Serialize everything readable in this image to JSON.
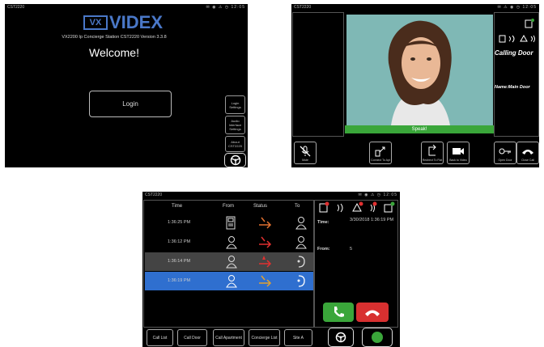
{
  "screen1": {
    "status_app": "CST2220",
    "status_icons": "✉ ◉ ⚠ ◷ 12:05",
    "logo_mark": "VX",
    "logo_text": "VIDEX",
    "version": "VX2200 Ip Concierge Station CST2220 Version 3.3.8",
    "welcome": "Welcome!",
    "login_button": "Login",
    "side_buttons": [
      "Login Settings",
      "Audio Interface Settings",
      "About CST2220"
    ]
  },
  "screen2": {
    "status_app": "CST2220",
    "status_icons": "✉ ⚠ ◉ ◷ 12:05",
    "speak_label": "Speak!",
    "calling_door": "Calling Door",
    "name_label": "Name:Main Door",
    "buttons": [
      "Mute",
      "Connect To Apt",
      "Redirect To Flat",
      "Back to Video",
      "Open Door",
      "Close Call"
    ]
  },
  "screen3": {
    "status_app": "CST2220",
    "status_icons": "✉ ◉ ⚠ ◷ 12:05",
    "headers": [
      "Time",
      "From",
      "Status",
      "To"
    ],
    "rows": [
      {
        "time": "1:36:25 PM",
        "status_color": "#e07030"
      },
      {
        "time": "1:36:12 PM",
        "status_color": "#e03030"
      },
      {
        "time": "1:36:14 PM",
        "status_color": "#e03030"
      },
      {
        "time": "1:36:19 PM",
        "status_color": "#e0a030"
      }
    ],
    "detail_time_label": "Time:",
    "detail_time_value": "3/30/2018 1:36:19 PM",
    "detail_from_label": "From:",
    "detail_from_value": "5",
    "tabs": [
      "Call List",
      "Call Door",
      "Call Apartment",
      "Concierge List",
      "Site A"
    ],
    "colors": {
      "accept": "#3aa63a",
      "reject": "#d83030",
      "selected_row": "#2f6fcf",
      "highlight_row": "#444444"
    }
  }
}
